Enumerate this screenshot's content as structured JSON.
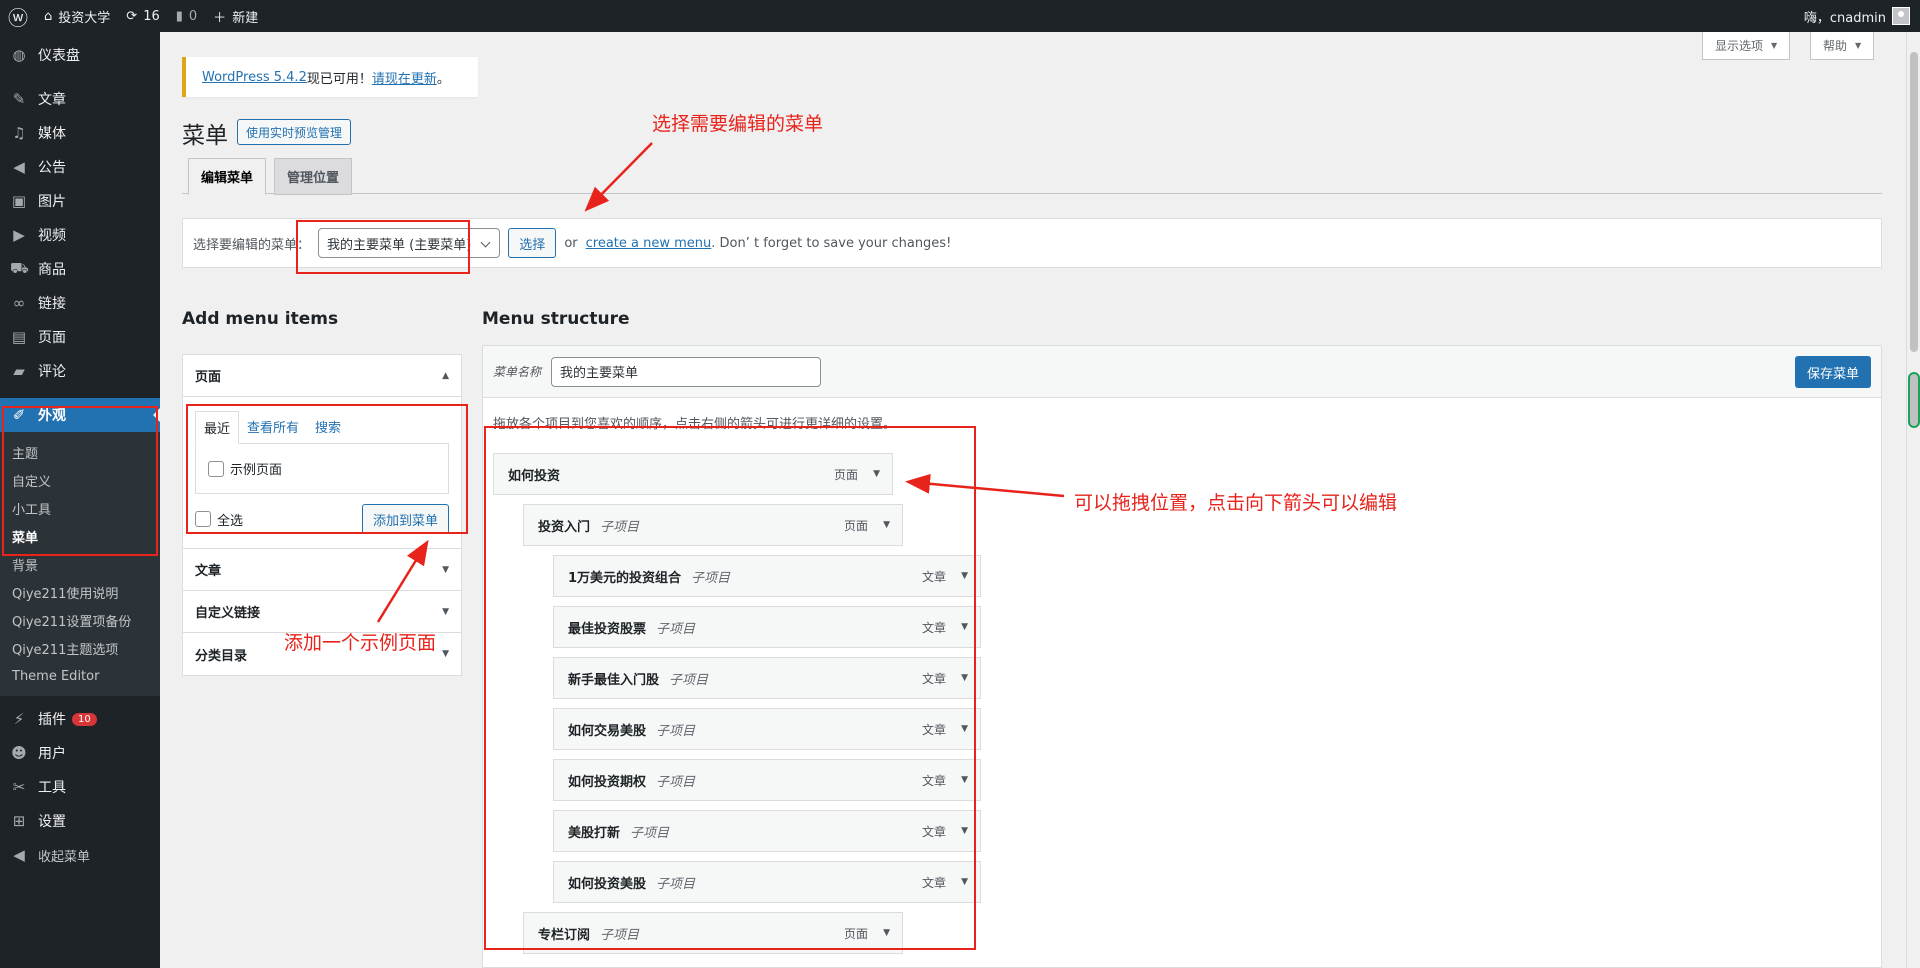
{
  "adminbar": {
    "site_name": "投资大学",
    "updates_count": "16",
    "comments_count": "0",
    "new_label": "新建",
    "greeting": "嗨，cnadmin"
  },
  "sidebar": {
    "items": [
      {
        "label": "仪表盘",
        "icon": "dashboard-icon"
      },
      {
        "label": "文章",
        "icon": "pin-icon"
      },
      {
        "label": "媒体",
        "icon": "media-icon"
      },
      {
        "label": "公告",
        "icon": "megaphone-icon"
      },
      {
        "label": "图片",
        "icon": "image-icon"
      },
      {
        "label": "视频",
        "icon": "video-icon"
      },
      {
        "label": "商品",
        "icon": "cart-icon"
      },
      {
        "label": "链接",
        "icon": "link-icon"
      },
      {
        "label": "页面",
        "icon": "page-icon"
      },
      {
        "label": "评论",
        "icon": "comment-icon"
      },
      {
        "label": "外观",
        "icon": "brush-icon"
      },
      {
        "label": "插件",
        "icon": "plugin-icon",
        "badge": "10"
      },
      {
        "label": "用户",
        "icon": "user-icon"
      },
      {
        "label": "工具",
        "icon": "wrench-icon"
      },
      {
        "label": "设置",
        "icon": "settings-icon"
      },
      {
        "label": "收起菜单",
        "icon": "collapse-icon"
      }
    ],
    "appearance_sub": [
      "主题",
      "自定义",
      "小工具",
      "菜单",
      "背景",
      "Qiye211使用说明",
      "Qiye211设置项备份",
      "Qiye211主题选项",
      "Theme Editor"
    ]
  },
  "screen_options": "显示选项",
  "help": "帮助",
  "notice": {
    "link1": "WordPress 5.4.2",
    "middle": "现已可用！",
    "link2": "请现在更新",
    "end": "。"
  },
  "page": {
    "title": "菜单",
    "live_preview": "使用实时预览管理",
    "tab_edit": "编辑菜单",
    "tab_locations": "管理位置"
  },
  "manage": {
    "label": "选择要编辑的菜单：",
    "selected": "我的主要菜单 (主要菜单)",
    "select_button": "选择",
    "or": "or",
    "create_link": "create a new menu",
    "tail": ". Don’ t forget to save your changes!"
  },
  "add_items": {
    "heading": "Add menu items",
    "pages_header": "页面",
    "tab_recent": "最近",
    "tab_all": "查看所有",
    "tab_search": "搜索",
    "sample_page": "示例页面",
    "select_all": "全选",
    "add_button": "添加到菜单",
    "posts_header": "文章",
    "custom_links_header": "自定义链接",
    "categories_header": "分类目录"
  },
  "structure": {
    "heading": "Menu structure",
    "name_label": "菜单名称",
    "name_value": "我的主要菜单",
    "save_button": "保存菜单",
    "instructions": "拖放各个项目到您喜欢的顺序，点击右侧的箭头可进行更详细的设置。",
    "subitem_label": "子项目",
    "items": [
      {
        "title": "如何投资",
        "type": "页面",
        "depth": 0,
        "sub": false
      },
      {
        "title": "投资入门",
        "type": "页面",
        "depth": 1,
        "sub": true
      },
      {
        "title": "1万美元的投资组合",
        "type": "文章",
        "depth": 2,
        "sub": true
      },
      {
        "title": "最佳投资股票",
        "type": "文章",
        "depth": 2,
        "sub": true
      },
      {
        "title": "新手最佳入门股",
        "type": "文章",
        "depth": 2,
        "sub": true
      },
      {
        "title": "如何交易美股",
        "type": "文章",
        "depth": 2,
        "sub": true
      },
      {
        "title": "如何投资期权",
        "type": "文章",
        "depth": 2,
        "sub": true
      },
      {
        "title": "美股打新",
        "type": "文章",
        "depth": 2,
        "sub": true
      },
      {
        "title": "如何投资美股",
        "type": "文章",
        "depth": 2,
        "sub": true
      },
      {
        "title": "专栏订阅",
        "type": "页面",
        "depth": 1,
        "sub": true
      }
    ]
  },
  "annotations": {
    "select_menu": "选择需要编辑的菜单",
    "add_page": "添加一个示例页面",
    "drag_edit": "可以拖拽位置，点击向下箭头可以编辑",
    "color": "#e8231b"
  }
}
